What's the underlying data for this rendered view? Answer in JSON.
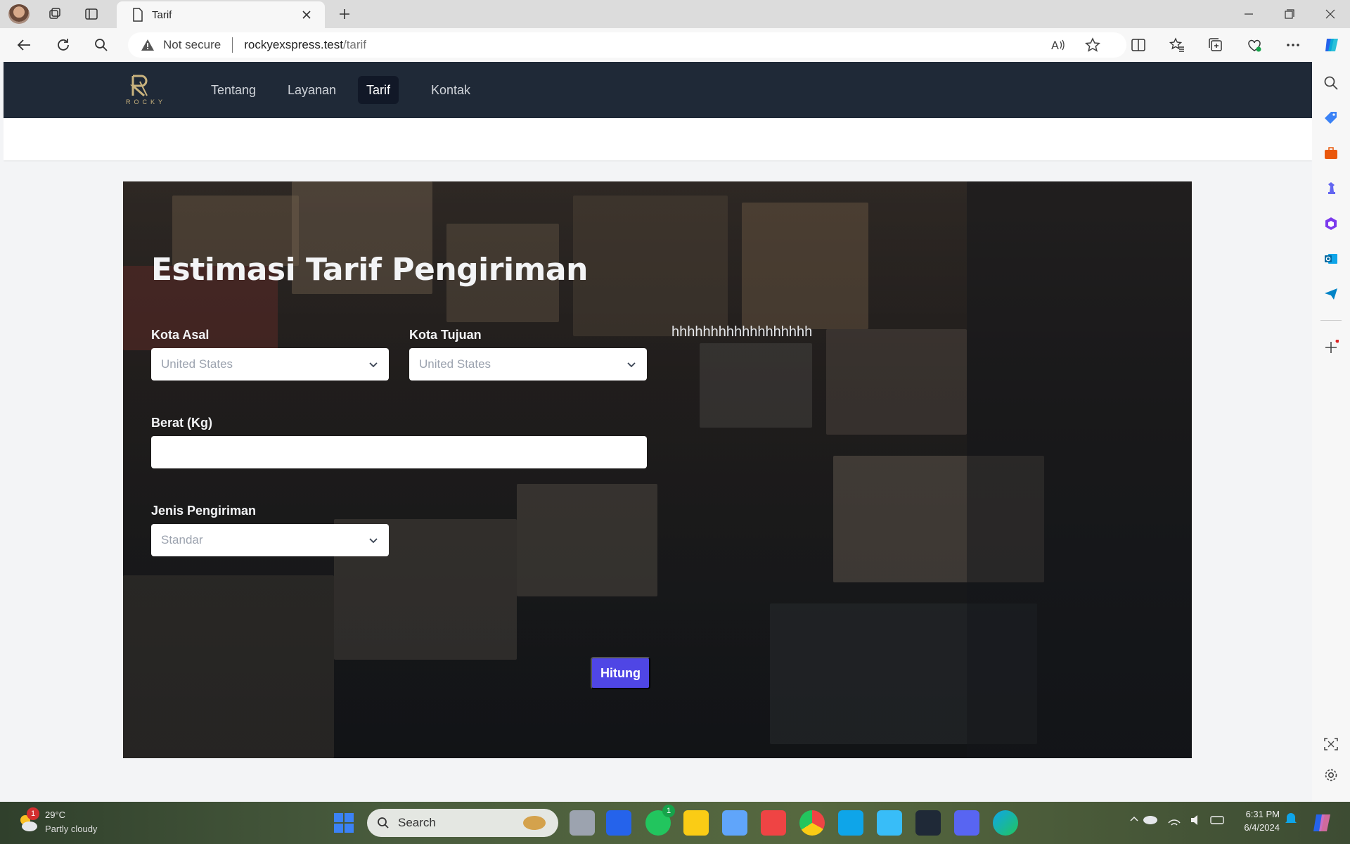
{
  "browser": {
    "tab_title": "Tarif",
    "security_label": "Not secure",
    "url_host": "rockyexspress.test",
    "url_path": "/tarif"
  },
  "site": {
    "logo_text": "ROCKY",
    "nav": [
      {
        "label": "Tentang",
        "active": false
      },
      {
        "label": "Layanan",
        "active": false
      },
      {
        "label": "Tarif",
        "active": true
      },
      {
        "label": "Kontak",
        "active": false
      }
    ]
  },
  "form": {
    "title": "Estimasi Tarif Pengiriman",
    "side_text": "hhhhhhhhhhhhhhhhhh",
    "origin_label": "Kota Asal",
    "origin_value": "United States",
    "destination_label": "Kota Tujuan",
    "destination_value": "United States",
    "weight_label": "Berat (Kg)",
    "weight_value": "",
    "shipping_label": "Jenis Pengiriman",
    "shipping_value": "Standar",
    "submit_label": "Hitung",
    "submit_color": "#4f46e5"
  },
  "taskbar": {
    "weather_temp": "29°C",
    "weather_desc": "Partly cloudy",
    "weather_badge": "1",
    "search_placeholder": "Search",
    "whatsapp_badge": "1",
    "time": "6:31 PM",
    "date": "6/4/2024"
  },
  "colors": {
    "nav_bg": "#1f2937",
    "nav_active_bg": "#111827",
    "accent": "#4f46e5"
  }
}
